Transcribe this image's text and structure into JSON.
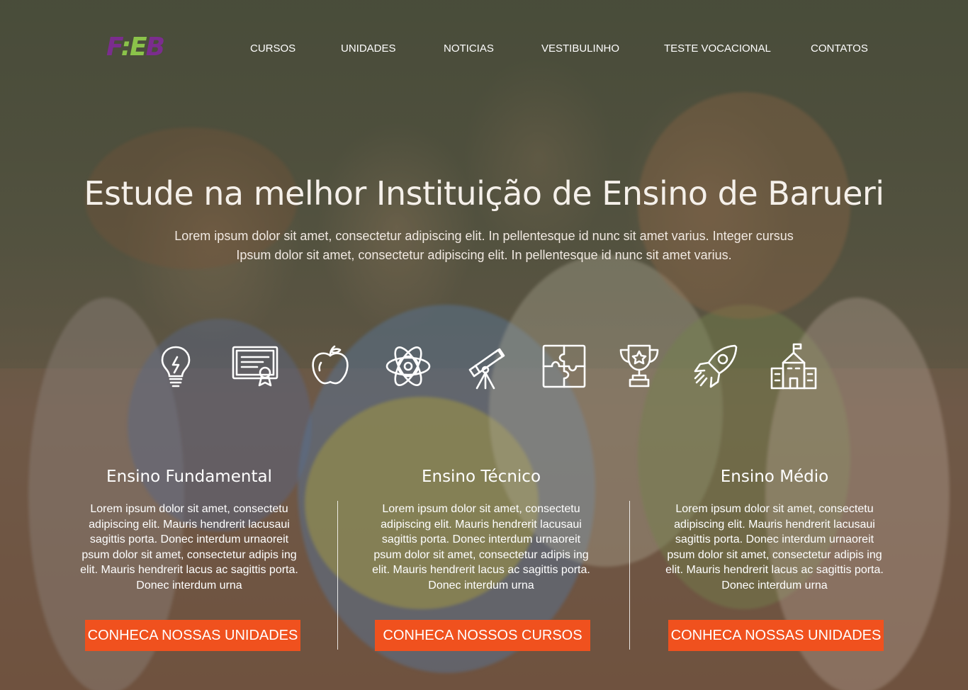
{
  "header": {
    "logo_text": "FIEB",
    "nav": [
      {
        "label": "CURSOS"
      },
      {
        "label": "UNIDADES"
      },
      {
        "label": "NOTICIAS"
      },
      {
        "label": "VESTIBULINHO"
      },
      {
        "label": "TESTE VOCACIONAL"
      },
      {
        "label": "CONTATOS"
      }
    ]
  },
  "hero": {
    "title": "Estude na melhor Instituição de Ensino de Barueri",
    "subtitle_line1": "Lorem ipsum dolor sit amet, consectetur adipiscing elit. In pellentesque id nunc sit amet varius. Integer cursus",
    "subtitle_line2": "Ipsum dolor sit amet, consectetur adipiscing elit. In pellentesque id nunc sit amet varius."
  },
  "icons": [
    "lightbulb-icon",
    "certificate-icon",
    "apple-icon",
    "atom-icon",
    "telescope-icon",
    "puzzle-icon",
    "trophy-icon",
    "rocket-icon",
    "school-icon"
  ],
  "columns": [
    {
      "title": "Ensino Fundamental",
      "text": "Lorem ipsum dolor sit amet, consectetu adipiscing elit. Mauris hendrerit lacusaui sagittis porta. Donec interdum urnaoreit psum dolor sit amet, consectetur adipis ing elit. Mauris hendrerit lacus ac sagittis porta. Donec interdum urna",
      "button": "CONHECA NOSSAS UNIDADES"
    },
    {
      "title": "Ensino Técnico",
      "text": "Lorem ipsum dolor sit amet, consectetu adipiscing elit. Mauris hendrerit lacusaui sagittis porta. Donec interdum urnaoreit psum dolor sit amet, consectetur adipis ing elit. Mauris hendrerit lacus ac sagittis porta. Donec interdum urna",
      "button": "CONHECA NOSSOS CURSOS"
    },
    {
      "title": "Ensino Médio",
      "text": "Lorem ipsum dolor sit amet, consectetu adipiscing elit. Mauris hendrerit lacusaui sagittis porta. Donec interdum urnaoreit psum dolor sit amet, consectetur adipis ing elit. Mauris hendrerit lacus ac sagittis porta. Donec interdum urna",
      "button": "CONHECA NOSSAS UNIDADES"
    }
  ],
  "colors": {
    "button_bg": "#f0511e",
    "logo_purple": "#7b2d8e",
    "logo_green": "#8bc34a"
  }
}
